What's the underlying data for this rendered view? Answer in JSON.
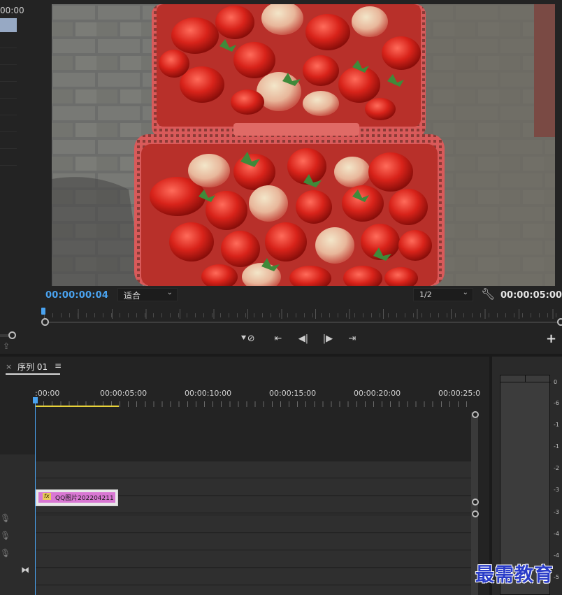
{
  "source_panel": {
    "timecode": "00:00"
  },
  "program_monitor": {
    "current_timecode": "00:00:00:04",
    "fit_select": "适合",
    "resolution_select": "1/2",
    "duration_timecode": "00:00:05:00",
    "transport_icons": [
      "add-marker-icon",
      "go-to-in-icon",
      "step-back-icon",
      "step-forward-icon",
      "go-to-out-icon",
      "plus-icon"
    ]
  },
  "timeline": {
    "close_glyph": "×",
    "sequence_name": "序列 01",
    "menu_glyph": "≡",
    "ruler_labels": [
      ":00:00",
      "00:00:05:00",
      "00:00:10:00",
      "00:00:15:00",
      "00:00:20:00",
      "00:00:25:0"
    ],
    "clip": {
      "fx_label": "fx",
      "name": "QQ图片202204211"
    }
  },
  "audio_meter": {
    "scale": [
      "0",
      "-6",
      "-1",
      "-1",
      "-2",
      "-3",
      "-3",
      "-4",
      "-4",
      "-5"
    ]
  },
  "watermark": "最需教育",
  "colors": {
    "accent_blue": "#4aa3f0",
    "clip_pink": "#d977d3",
    "work_area_yellow": "#e8d23a"
  }
}
